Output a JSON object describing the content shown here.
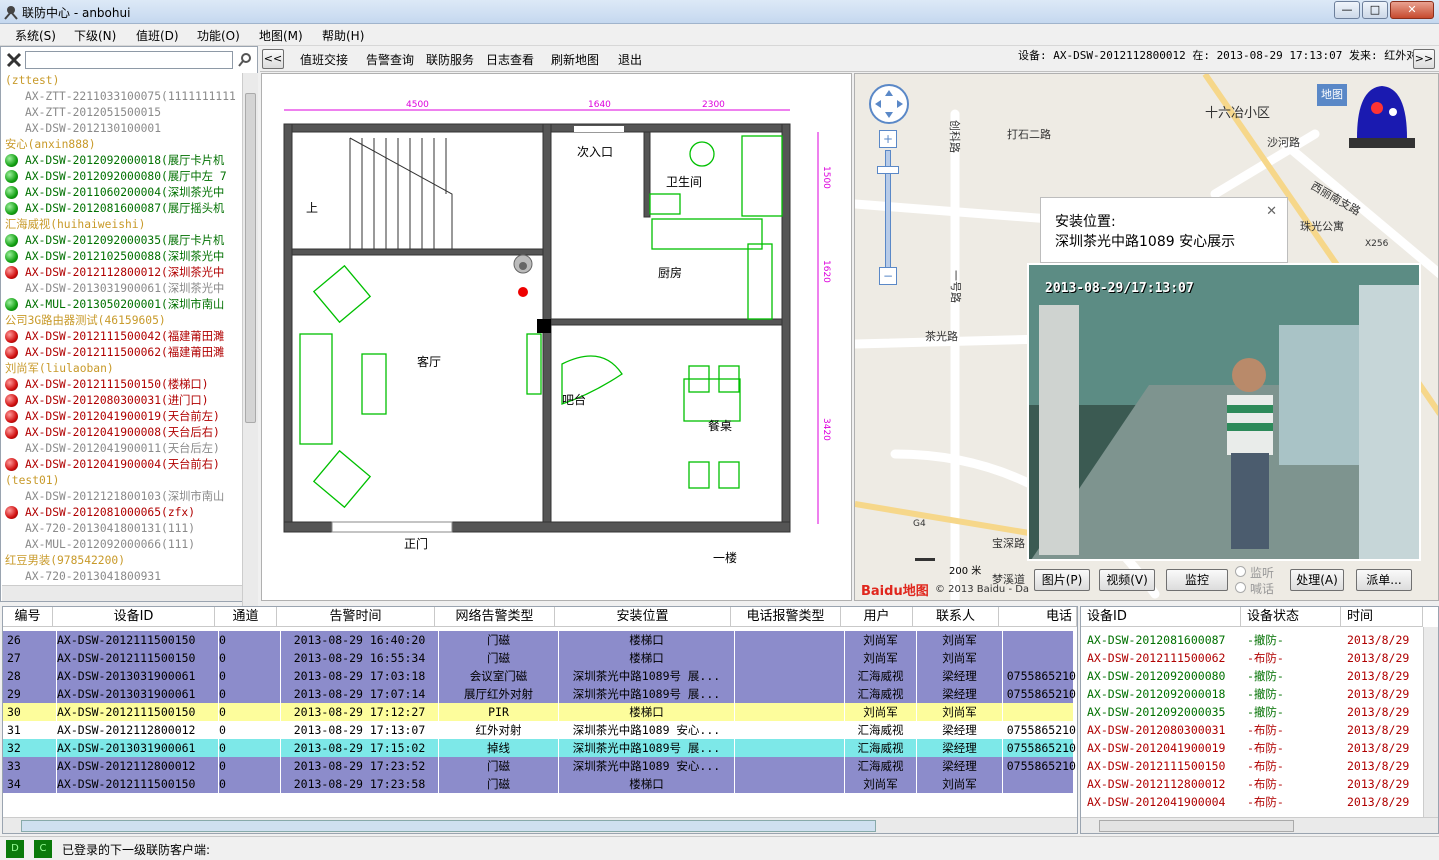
{
  "window": {
    "title": "联防中心 - anbohui",
    "min": "—",
    "max": "□",
    "close": "✕"
  },
  "menu": [
    "系统(S)",
    "下级(N)",
    "值班(D)",
    "功能(O)",
    "地图(M)",
    "帮助(H)"
  ],
  "toolbar": {
    "nav_prev": "<<",
    "items": [
      "值班交接",
      "告警查询",
      "联防服务",
      "日志查看",
      "刷新地图",
      "退出"
    ],
    "device_info": "设备: AX-DSW-2012112800012 在: 2013-08-29 17:13:07 发来: 红外对射",
    "nav_next": ">>"
  },
  "tree": [
    {
      "text": "(zttest)",
      "type": "grp"
    },
    {
      "text": "AX-ZTT-2211033100075(1111111111",
      "type": "dev-n"
    },
    {
      "text": "AX-ZTT-2012051500015",
      "type": "dev-n"
    },
    {
      "text": "AX-DSW-2012130100001",
      "type": "dev-n"
    },
    {
      "text": "安心(anxin888)",
      "type": "grp"
    },
    {
      "text": "AX-DSW-2012092000018(展厅卡片机",
      "type": "dev-g",
      "dot": "g"
    },
    {
      "text": "AX-DSW-2012092000080(展厅中左 7",
      "type": "dev-g",
      "dot": "g"
    },
    {
      "text": "AX-DSW-2011060200004(深圳茶光中",
      "type": "dev-g",
      "dot": "g"
    },
    {
      "text": "AX-DSW-2012081600087(展厅摇头机",
      "type": "dev-g",
      "dot": "g"
    },
    {
      "text": "汇海威视(huihaiweishi)",
      "type": "grp"
    },
    {
      "text": "AX-DSW-2012092000035(展厅卡片机",
      "type": "dev-g",
      "dot": "g"
    },
    {
      "text": "AX-DSW-2012102500088(深圳茶光中",
      "type": "dev-g",
      "dot": "g"
    },
    {
      "text": "AX-DSW-2012112800012(深圳茶光中",
      "type": "dev-r",
      "dot": "r"
    },
    {
      "text": "AX-DSW-2013031900061(深圳茶光中",
      "type": "dev-n"
    },
    {
      "text": "AX-MUL-2013050200001(深圳市南山",
      "type": "dev-g",
      "dot": "g"
    },
    {
      "text": "公司3G路由器测试(46159605)",
      "type": "grp"
    },
    {
      "text": "AX-DSW-2012111500042(福建莆田濉",
      "type": "dev-r",
      "dot": "r"
    },
    {
      "text": "AX-DSW-2012111500062(福建莆田濉",
      "type": "dev-r",
      "dot": "r"
    },
    {
      "text": "刘尚军(liulaoban)",
      "type": "grp"
    },
    {
      "text": "AX-DSW-2012111500150(楼梯口)",
      "type": "dev-r",
      "dot": "r"
    },
    {
      "text": "AX-DSW-2012080300031(进门口)",
      "type": "dev-r",
      "dot": "r"
    },
    {
      "text": "AX-DSW-2012041900019(天台前左)",
      "type": "dev-r",
      "dot": "r"
    },
    {
      "text": "AX-DSW-2012041900008(天台后右)",
      "type": "dev-r",
      "dot": "r"
    },
    {
      "text": "AX-DSW-2012041900011(天台后左)",
      "type": "dev-n"
    },
    {
      "text": "AX-DSW-2012041900004(天台前右)",
      "type": "dev-r",
      "dot": "r"
    },
    {
      "text": "(test01)",
      "type": "grp"
    },
    {
      "text": "AX-DSW-2012121800103(深圳市南山",
      "type": "dev-n"
    },
    {
      "text": "AX-DSW-2012081000065(zfx)",
      "type": "dev-r",
      "dot": "r"
    },
    {
      "text": "AX-720-2013041800131(111)",
      "type": "dev-n"
    },
    {
      "text": "AX-MUL-2012092000066(111)",
      "type": "dev-n"
    },
    {
      "text": "红豆男装(978542200)",
      "type": "grp"
    },
    {
      "text": "AX-720-2013041800931",
      "type": "dev-n"
    }
  ],
  "floorplan": {
    "dims_top": [
      "4500",
      "1640",
      "2300"
    ],
    "dims_right": [
      "1500",
      "1620",
      "3420"
    ],
    "rooms": {
      "stairs": "上",
      "entry": "次入口",
      "bath": "卫生间",
      "kitchen": "厨房",
      "living": "客厅",
      "bar": "吧台",
      "dining": "餐桌",
      "door": "正门",
      "floor": "一楼"
    }
  },
  "map": {
    "places": [
      "十六冶小区",
      "打石二路",
      "创科路",
      "沙河路",
      "西丽南支路",
      "茶光路",
      "一号路",
      "珠光公寓",
      "宝深路",
      "梦溪道",
      "X256",
      "G4"
    ],
    "scale": "200 米",
    "copyright": "© 2013 Baidu - Da",
    "logo": "Baidu地图",
    "map_btn": "地图",
    "popup_title": "安装位置:",
    "popup_addr": "深圳茶光中路1089 安心展示",
    "popup_close": "✕",
    "cam_timestamp": "2013-08-29/17:13:07",
    "buttons": [
      "图片(P)",
      "视频(V)",
      "监控",
      "处理(A)",
      "派单..."
    ],
    "radios": [
      "监听",
      "喊话"
    ]
  },
  "alarm_table": {
    "headers": [
      "编号",
      "设备ID",
      "通道",
      "告警时间",
      "网络告警类型",
      "安装位置",
      "电话报警类型",
      "用户",
      "联系人",
      "电话"
    ],
    "rows": [
      {
        "style": "blue",
        "cells": [
          "26",
          "AX-DSW-2012111500150",
          "0",
          "2013-08-29 16:40:20",
          "门磁",
          "楼梯口",
          "",
          "刘尚军",
          "刘尚军",
          ""
        ]
      },
      {
        "style": "blue",
        "cells": [
          "27",
          "AX-DSW-2012111500150",
          "0",
          "2013-08-29 16:55:34",
          "门磁",
          "楼梯口",
          "",
          "刘尚军",
          "刘尚军",
          ""
        ]
      },
      {
        "style": "blue",
        "cells": [
          "28",
          "AX-DSW-2013031900061",
          "0",
          "2013-08-29 17:03:18",
          "会议室门磁",
          "深圳茶光中路1089号 展...",
          "",
          "汇海威视",
          "梁经理",
          "0755865210"
        ]
      },
      {
        "style": "blue",
        "cells": [
          "29",
          "AX-DSW-2013031900061",
          "0",
          "2013-08-29 17:07:14",
          "展厅红外对射",
          "深圳茶光中路1089号 展...",
          "",
          "汇海威视",
          "梁经理",
          "0755865210"
        ]
      },
      {
        "style": "yellow",
        "cells": [
          "30",
          "AX-DSW-2012111500150",
          "0",
          "2013-08-29 17:12:27",
          "PIR",
          "楼梯口",
          "",
          "刘尚军",
          "刘尚军",
          ""
        ]
      },
      {
        "style": "white",
        "cells": [
          "31",
          "AX-DSW-2012112800012",
          "0",
          "2013-08-29 17:13:07",
          "红外对射",
          "深圳茶光中路1089 安心...",
          "",
          "汇海威视",
          "梁经理",
          "0755865210"
        ]
      },
      {
        "style": "cyan",
        "cells": [
          "32",
          "AX-DSW-2013031900061",
          "0",
          "2013-08-29 17:15:02",
          "掉线",
          "深圳茶光中路1089号 展...",
          "",
          "汇海威视",
          "梁经理",
          "0755865210"
        ]
      },
      {
        "style": "blue",
        "cells": [
          "33",
          "AX-DSW-2012112800012",
          "0",
          "2013-08-29 17:23:52",
          "门磁",
          "深圳茶光中路1089 安心...",
          "",
          "汇海威视",
          "梁经理",
          "0755865210"
        ]
      },
      {
        "style": "blue",
        "cells": [
          "34",
          "AX-DSW-2012111500150",
          "0",
          "2013-08-29 17:23:58",
          "门磁",
          "楼梯口",
          "",
          "刘尚军",
          "刘尚军",
          ""
        ]
      }
    ]
  },
  "status_table": {
    "headers": [
      "设备ID",
      "设备状态",
      "时间"
    ],
    "rows": [
      {
        "c": "g",
        "cells": [
          "AX-DSW-2012081600087",
          "-撤防-",
          "2013/8/29"
        ]
      },
      {
        "c": "r",
        "cells": [
          "AX-DSW-2012111500062",
          "-布防-",
          "2013/8/29"
        ]
      },
      {
        "c": "g",
        "cells": [
          "AX-DSW-2012092000080",
          "-撤防-",
          "2013/8/29"
        ]
      },
      {
        "c": "g",
        "cells": [
          "AX-DSW-2012092000018",
          "-撤防-",
          "2013/8/29"
        ]
      },
      {
        "c": "g",
        "cells": [
          "AX-DSW-2012092000035",
          "-撤防-",
          "2013/8/29"
        ]
      },
      {
        "c": "r",
        "cells": [
          "AX-DSW-2012080300031",
          "-布防-",
          "2013/8/29"
        ]
      },
      {
        "c": "r",
        "cells": [
          "AX-DSW-2012041900019",
          "-布防-",
          "2013/8/29"
        ]
      },
      {
        "c": "r",
        "cells": [
          "AX-DSW-2012111500150",
          "-布防-",
          "2013/8/29"
        ]
      },
      {
        "c": "r",
        "cells": [
          "AX-DSW-2012112800012",
          "-布防-",
          "2013/8/29"
        ]
      },
      {
        "c": "r",
        "cells": [
          "AX-DSW-2012041900004",
          "-布防-",
          "2013/8/29"
        ]
      }
    ]
  },
  "statusbar": {
    "ind1": "D",
    "ind2": "C",
    "text": "已登录的下一级联防客户端:"
  }
}
